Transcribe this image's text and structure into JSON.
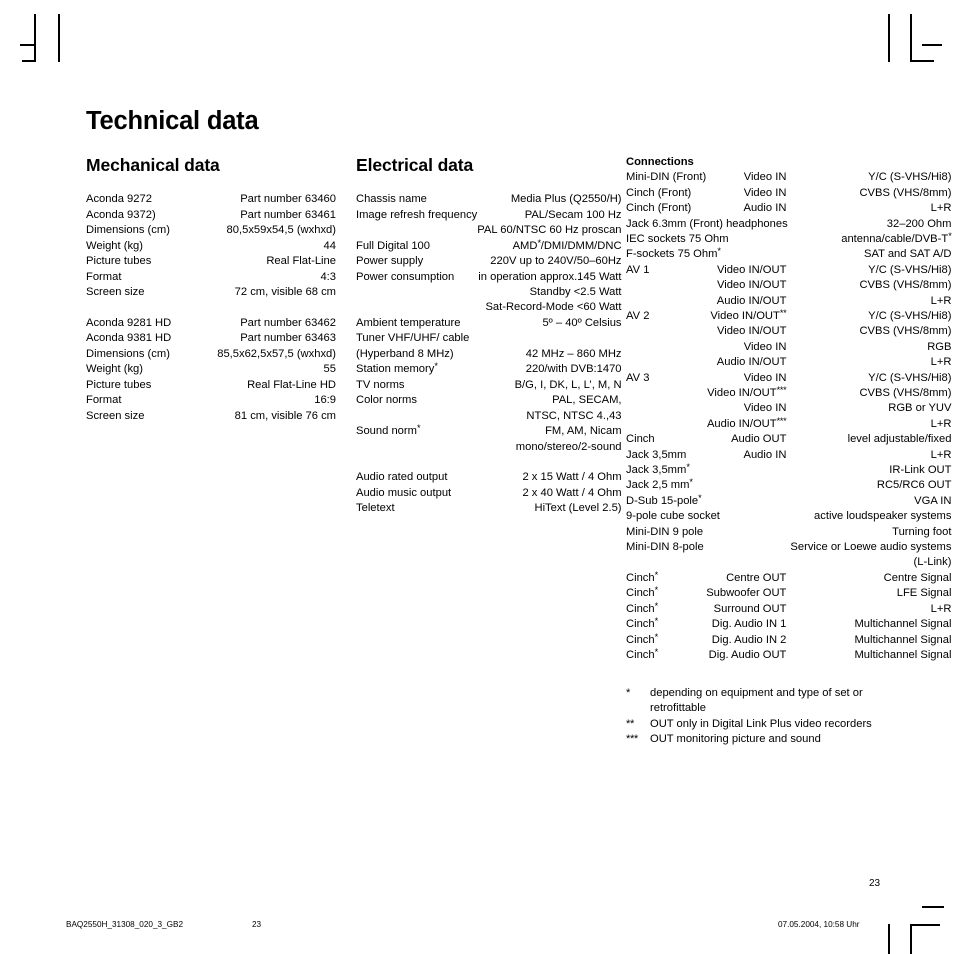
{
  "page": {
    "title": "Technical data",
    "page_number": "23"
  },
  "mechanical": {
    "heading": "Mechanical data",
    "group1": [
      {
        "key": "Aconda 9272",
        "value": "Part number 63460"
      },
      {
        "key": "Aconda 9372)",
        "value": "Part number 63461"
      },
      {
        "key": "Dimensions (cm)",
        "value": "80,5x59x54,5 (wxhxd)"
      },
      {
        "key": "Weight (kg)",
        "value": "44"
      },
      {
        "key": "Picture tubes",
        "value": "Real Flat-Line"
      },
      {
        "key": "Format",
        "value": "4:3"
      },
      {
        "key": "Screen size",
        "value": "72 cm, visible 68 cm"
      }
    ],
    "group2": [
      {
        "key": "Aconda 9281 HD",
        "value": "Part number 63462"
      },
      {
        "key": "Aconda 9381 HD",
        "value": "Part number 63463"
      },
      {
        "key": "Dimensions (cm)",
        "value": "85,5x62,5x57,5 (wxhxd)"
      },
      {
        "key": "Weight (kg)",
        "value": "55"
      },
      {
        "key": "Picture tubes",
        "value": "Real Flat-Line HD"
      },
      {
        "key": "Format",
        "value": "16:9"
      },
      {
        "key": "Screen size",
        "value": "81 cm, visible 76 cm"
      }
    ]
  },
  "electrical": {
    "heading": "Electrical data",
    "rows": [
      {
        "key": "Chassis name",
        "value": "Media Plus (Q2550/H)"
      },
      {
        "key": "Image refresh frequency",
        "value": "PAL/Secam 100 Hz"
      },
      {
        "key": "",
        "value": "PAL 60/NTSC 60 Hz proscan"
      },
      {
        "key": "Full Digital 100",
        "value": "AMD",
        "value_sup": "*",
        "value_tail": "/DMI/DMM/DNC"
      },
      {
        "key": "Power supply",
        "value": "220V up to 240V/50–60Hz"
      },
      {
        "key": "Power consumption",
        "value": "in operation approx.145 Watt"
      },
      {
        "key": "",
        "value": "Standby <2.5 Watt"
      },
      {
        "key": "",
        "value": "Sat-Record-Mode <60 Watt"
      },
      {
        "key": "Ambient temperature",
        "value": "5º – 40º Celsius"
      },
      {
        "key": "Tuner VHF/UHF/ cable",
        "value": ""
      },
      {
        "key": "(Hyperband 8 MHz)",
        "value": "42 MHz – 860 MHz"
      },
      {
        "key": "Station memory",
        "key_sup": "*",
        "value": "220/with DVB:1470"
      },
      {
        "key": "TV norms",
        "value": "B/G, I, DK, L, L’, M, N"
      },
      {
        "key": "Color norms",
        "value": "PAL, SECAM,"
      },
      {
        "key": "",
        "value": "NTSC, NTSC 4.,43"
      },
      {
        "key": "Sound norm",
        "key_sup": "*",
        "value": "FM, AM, Nicam"
      },
      {
        "key": "",
        "value": "mono/stereo/2-sound"
      },
      {
        "key": "__GAP__",
        "value": ""
      },
      {
        "key": "Audio rated output",
        "value": "2 x 15 Watt / 4 Ohm"
      },
      {
        "key": "Audio music output",
        "value": "2 x 40 Watt / 4 Ohm"
      },
      {
        "key": "Teletext",
        "value": "HiText (Level 2.5)"
      }
    ]
  },
  "connections": {
    "heading": "Connections",
    "rows": [
      {
        "c1": "Mini-DIN (Front)",
        "c2": "Video IN",
        "c3": "Y/C (S-VHS/Hi8)"
      },
      {
        "c1": "Cinch (Front)",
        "c2": "Video IN",
        "c3": "CVBS (VHS/8mm)"
      },
      {
        "c1": "Cinch (Front)",
        "c2": "Audio IN",
        "c3": "L+R"
      },
      {
        "merge": "Jack 6.3mm (Front) headphones",
        "c3": "32–200 Ohm"
      },
      {
        "merge": "IEC sockets 75 Ohm",
        "c3": "antenna/cable/DVB-T",
        "c3_sup": "*"
      },
      {
        "merge": "F-sockets 75 Ohm",
        "merge_sup": "*",
        "c3": "SAT and SAT A/D"
      },
      {
        "c1": "AV 1",
        "c2": "Video IN/OUT",
        "c3": "Y/C (S-VHS/Hi8)"
      },
      {
        "c1": "",
        "c2": "Video IN/OUT",
        "c3": "CVBS (VHS/8mm)"
      },
      {
        "c1": "",
        "c2": "Audio IN/OUT",
        "c3": "L+R"
      },
      {
        "c1": "AV 2",
        "c2": "Video IN/OUT",
        "c2_sup": "**",
        "c3": "Y/C (S-VHS/Hi8)"
      },
      {
        "c1": "",
        "c2": "Video IN/OUT",
        "c3": "CVBS (VHS/8mm)"
      },
      {
        "c1": "",
        "c2": "Video IN",
        "c3": "RGB"
      },
      {
        "c1": "",
        "c2": "Audio IN/OUT",
        "c3": "L+R"
      },
      {
        "c1": "AV 3",
        "c2": "Video IN",
        "c3": "Y/C (S-VHS/Hi8)"
      },
      {
        "c1": "",
        "c2": "Video IN/OUT",
        "c2_sup": "***",
        "c3": "CVBS (VHS/8mm)"
      },
      {
        "c1": "",
        "c2": "Video IN",
        "c3": "RGB or YUV"
      },
      {
        "c1": "",
        "c2": "Audio IN/OUT",
        "c2_sup": "***",
        "c3": "L+R"
      },
      {
        "c1": "Cinch",
        "c2": "Audio OUT",
        "c3": "level adjustable/fixed"
      },
      {
        "c1": "Jack 3,5mm",
        "c2": "Audio IN",
        "c3": "L+R"
      },
      {
        "c1": "Jack 3,5mm",
        "c1_sup": "*",
        "c2": "",
        "c3": "IR-Link OUT"
      },
      {
        "c1": "Jack 2,5 mm",
        "c1_sup": "*",
        "c2": "",
        "c3": "RC5/RC6 OUT"
      },
      {
        "c1": "D-Sub 15-pole",
        "c1_sup": "*",
        "c2": "",
        "c3": "VGA IN"
      },
      {
        "merge": " 9-pole cube socket",
        "c3": "active loudspeaker systems"
      },
      {
        "merge": "Mini-DIN 9 pole",
        "c3": "Turning foot"
      },
      {
        "merge": "Mini-DIN 8-pole",
        "c3": "Service or Loewe audio systems"
      },
      {
        "merge": "",
        "c3": "(L-Link)"
      },
      {
        "c1": "Cinch",
        "c1_sup": "*",
        "c2": "Centre OUT",
        "c3": "Centre Signal"
      },
      {
        "c1": "Cinch",
        "c1_sup": "*",
        "c2": "Subwoofer OUT",
        "c3": "LFE Signal"
      },
      {
        "c1": "Cinch",
        "c1_sup": "*",
        "c2": "Surround OUT",
        "c3": "L+R"
      },
      {
        "c1": "Cinch",
        "c1_sup": "*",
        "c2": "Dig. Audio IN 1",
        "c3": "Multichannel Signal"
      },
      {
        "c1": "Cinch",
        "c1_sup": "*",
        "c2": "Dig. Audio IN 2",
        "c3": "Multichannel Signal"
      },
      {
        "c1": "Cinch",
        "c1_sup": "*",
        "c2": "Dig. Audio OUT",
        "c3": "Multichannel Signal"
      }
    ]
  },
  "footnotes": [
    {
      "mark": "*",
      "text": "depending on equipment and type of set or",
      "cont": "retrofittable"
    },
    {
      "mark": "**",
      "text": "OUT only in Digital Link Plus video recorders",
      "cont": ""
    },
    {
      "mark": "***",
      "text": "OUT monitoring picture and sound",
      "cont": ""
    }
  ],
  "printer_footer": {
    "file": "BAQ2550H_31308_020_3_GB2",
    "page": "23",
    "date": "07.05.2004, 10:58 Uhr"
  }
}
